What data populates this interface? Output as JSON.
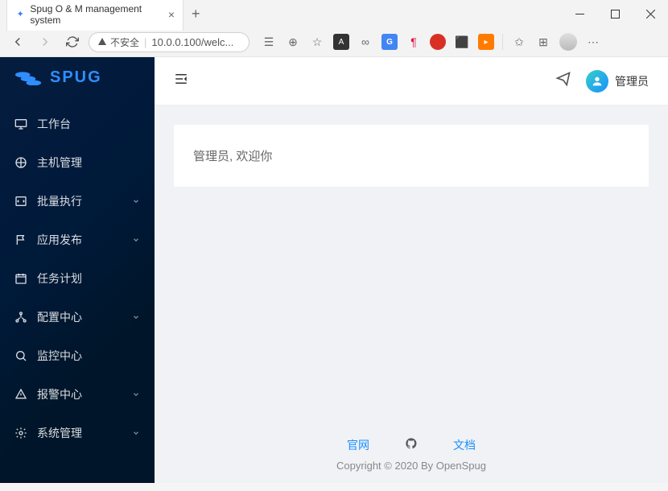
{
  "browser": {
    "tab_title": "Spug O & M management system",
    "url": "10.0.0.100/welc...",
    "insecure_label": "不安全"
  },
  "app": {
    "logo_text": "SPUG",
    "user_name": "管理员",
    "welcome_message": "管理员, 欢迎你"
  },
  "sidebar": {
    "items": [
      {
        "label": "工作台",
        "icon": "desktop",
        "submenu": false
      },
      {
        "label": "主机管理",
        "icon": "cloud-server",
        "submenu": false
      },
      {
        "label": "批量执行",
        "icon": "code",
        "submenu": true
      },
      {
        "label": "应用发布",
        "icon": "flag",
        "submenu": true
      },
      {
        "label": "任务计划",
        "icon": "schedule",
        "submenu": false
      },
      {
        "label": "配置中心",
        "icon": "deployment",
        "submenu": true
      },
      {
        "label": "监控中心",
        "icon": "monitor",
        "submenu": false
      },
      {
        "label": "报警中心",
        "icon": "alert",
        "submenu": true
      },
      {
        "label": "系统管理",
        "icon": "setting",
        "submenu": true
      }
    ]
  },
  "footer": {
    "link_site": "官网",
    "link_docs": "文档",
    "copyright": "Copyright © 2020 By OpenSpug"
  }
}
